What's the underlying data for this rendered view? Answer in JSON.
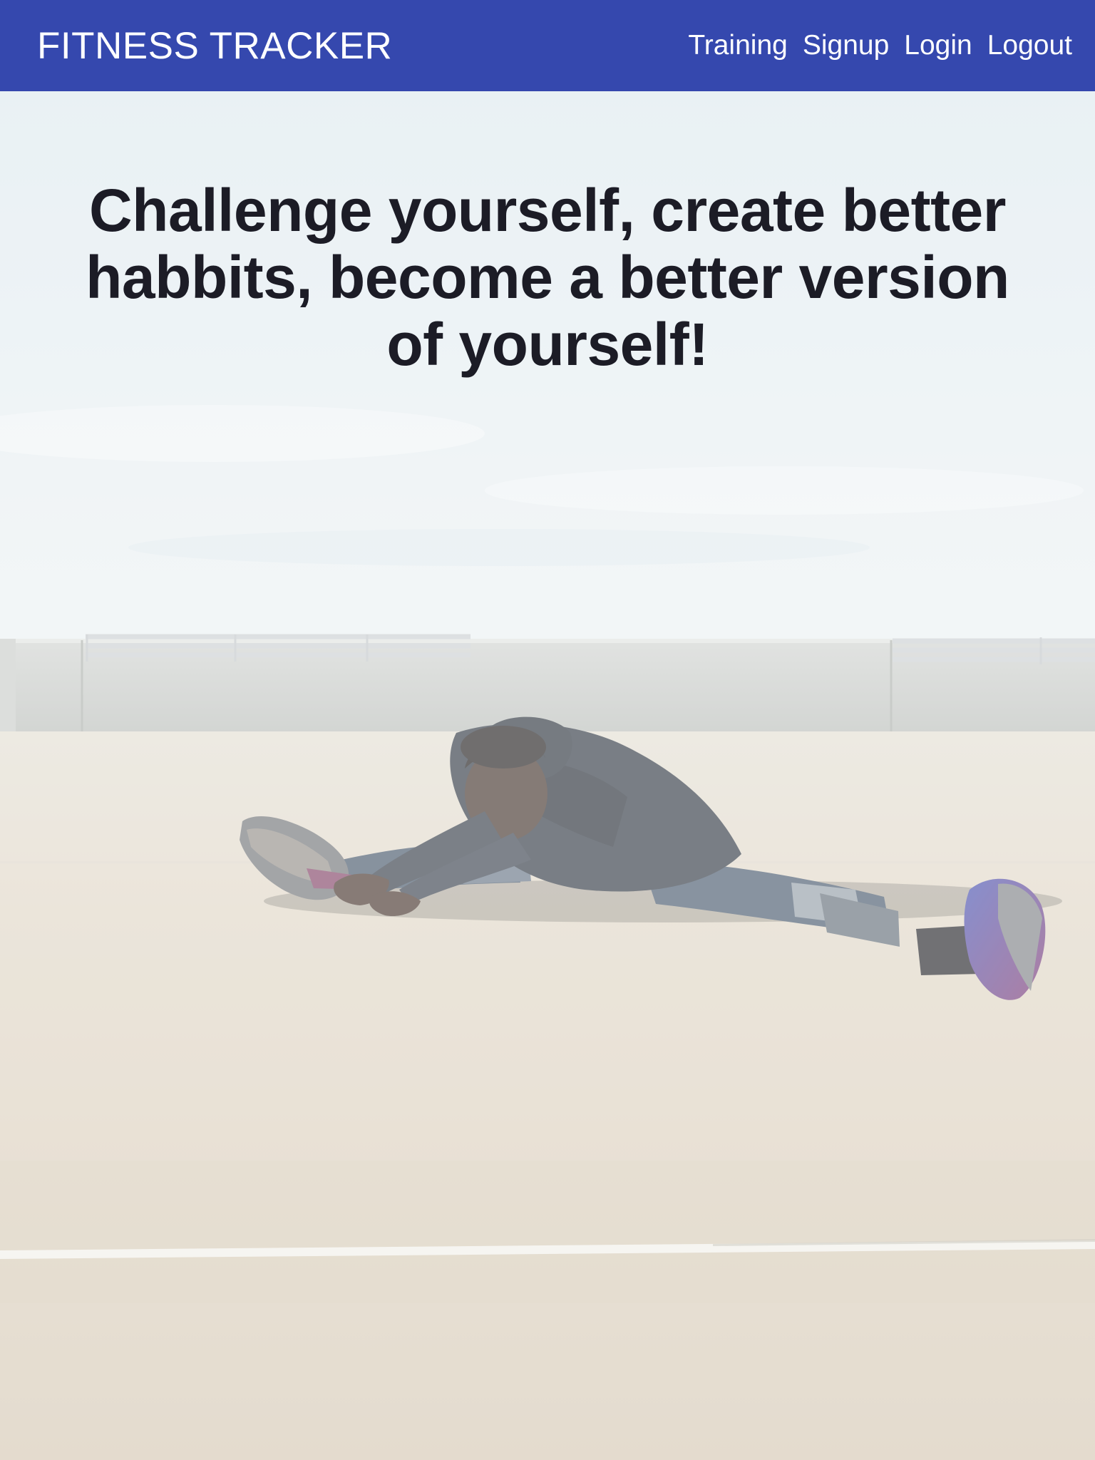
{
  "header": {
    "brand": "FITNESS TRACKER",
    "nav": [
      {
        "label": "Training"
      },
      {
        "label": "Signup"
      },
      {
        "label": "Login"
      },
      {
        "label": "Logout"
      }
    ]
  },
  "hero": {
    "headline": "Challenge yourself, create better habbits, become a better version of yourself!"
  },
  "colors": {
    "toolbar": "#3548ae",
    "toolbar_text": "#ffffff",
    "headline_text": "#1c1c26"
  }
}
